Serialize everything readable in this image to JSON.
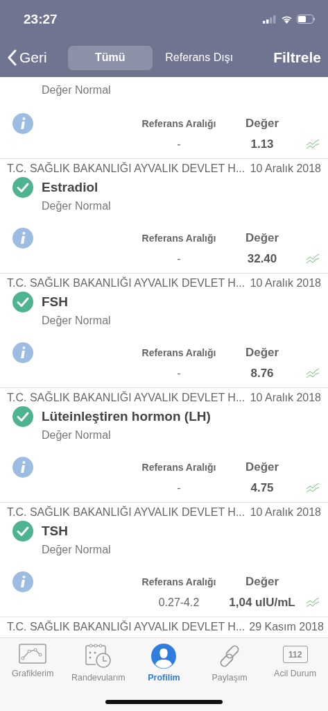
{
  "status_bar": {
    "time": "23:27"
  },
  "nav": {
    "back": "Geri",
    "segments": [
      {
        "label": "Tümü",
        "selected": true
      },
      {
        "label": "Referans Dışı",
        "selected": false
      }
    ],
    "action": "Filtrele"
  },
  "results": [
    {
      "kind": "partial_top",
      "status": "Değer Normal",
      "reference_label": "Referans Aralığı",
      "value_label": "Değer",
      "reference": "-",
      "value": "1.13"
    },
    {
      "kind": "full",
      "source": "T.C. SAĞLIK BAKANLIĞI AYVALIK DEVLET H...",
      "date": "10 Aralık 2018",
      "name": "Estradiol",
      "status": "Değer Normal",
      "reference_label": "Referans Aralığı",
      "value_label": "Değer",
      "reference": "-",
      "value": "32.40"
    },
    {
      "kind": "full",
      "source": "T.C. SAĞLIK BAKANLIĞI AYVALIK DEVLET H...",
      "date": "10 Aralık 2018",
      "name": "FSH",
      "status": "Değer Normal",
      "reference_label": "Referans Aralığı",
      "value_label": "Değer",
      "reference": "-",
      "value": "8.76"
    },
    {
      "kind": "full",
      "source": "T.C. SAĞLIK BAKANLIĞI AYVALIK DEVLET H...",
      "date": "10 Aralık 2018",
      "name": "Lüteinleştiren hormon (LH)",
      "status": "Değer Normal",
      "reference_label": "Referans Aralığı",
      "value_label": "Değer",
      "reference": "-",
      "value": "4.75"
    },
    {
      "kind": "full",
      "source": "T.C. SAĞLIK BAKANLIĞI AYVALIK DEVLET H...",
      "date": "10 Aralık 2018",
      "name": "TSH",
      "status": "Değer Normal",
      "reference_label": "Referans Aralığı",
      "value_label": "Değer",
      "reference": "0.27-4.2",
      "value": "1,04 uIU/mL"
    },
    {
      "kind": "partial_bottom",
      "source": "T.C. SAĞLIK BAKANLIĞI AYVALIK DEVLET H...",
      "date": "29 Kasım 2018"
    }
  ],
  "tab_bar": [
    {
      "kind": "chart",
      "label": "Grafiklerim",
      "selected": false
    },
    {
      "kind": "calendar",
      "label": "Randevularım",
      "selected": false
    },
    {
      "kind": "profile",
      "label": "Profilim",
      "selected": true
    },
    {
      "kind": "link",
      "label": "Paylaşım",
      "selected": false
    },
    {
      "kind": "emergency",
      "label": "Acil Durum",
      "badge": "112",
      "selected": false
    }
  ]
}
